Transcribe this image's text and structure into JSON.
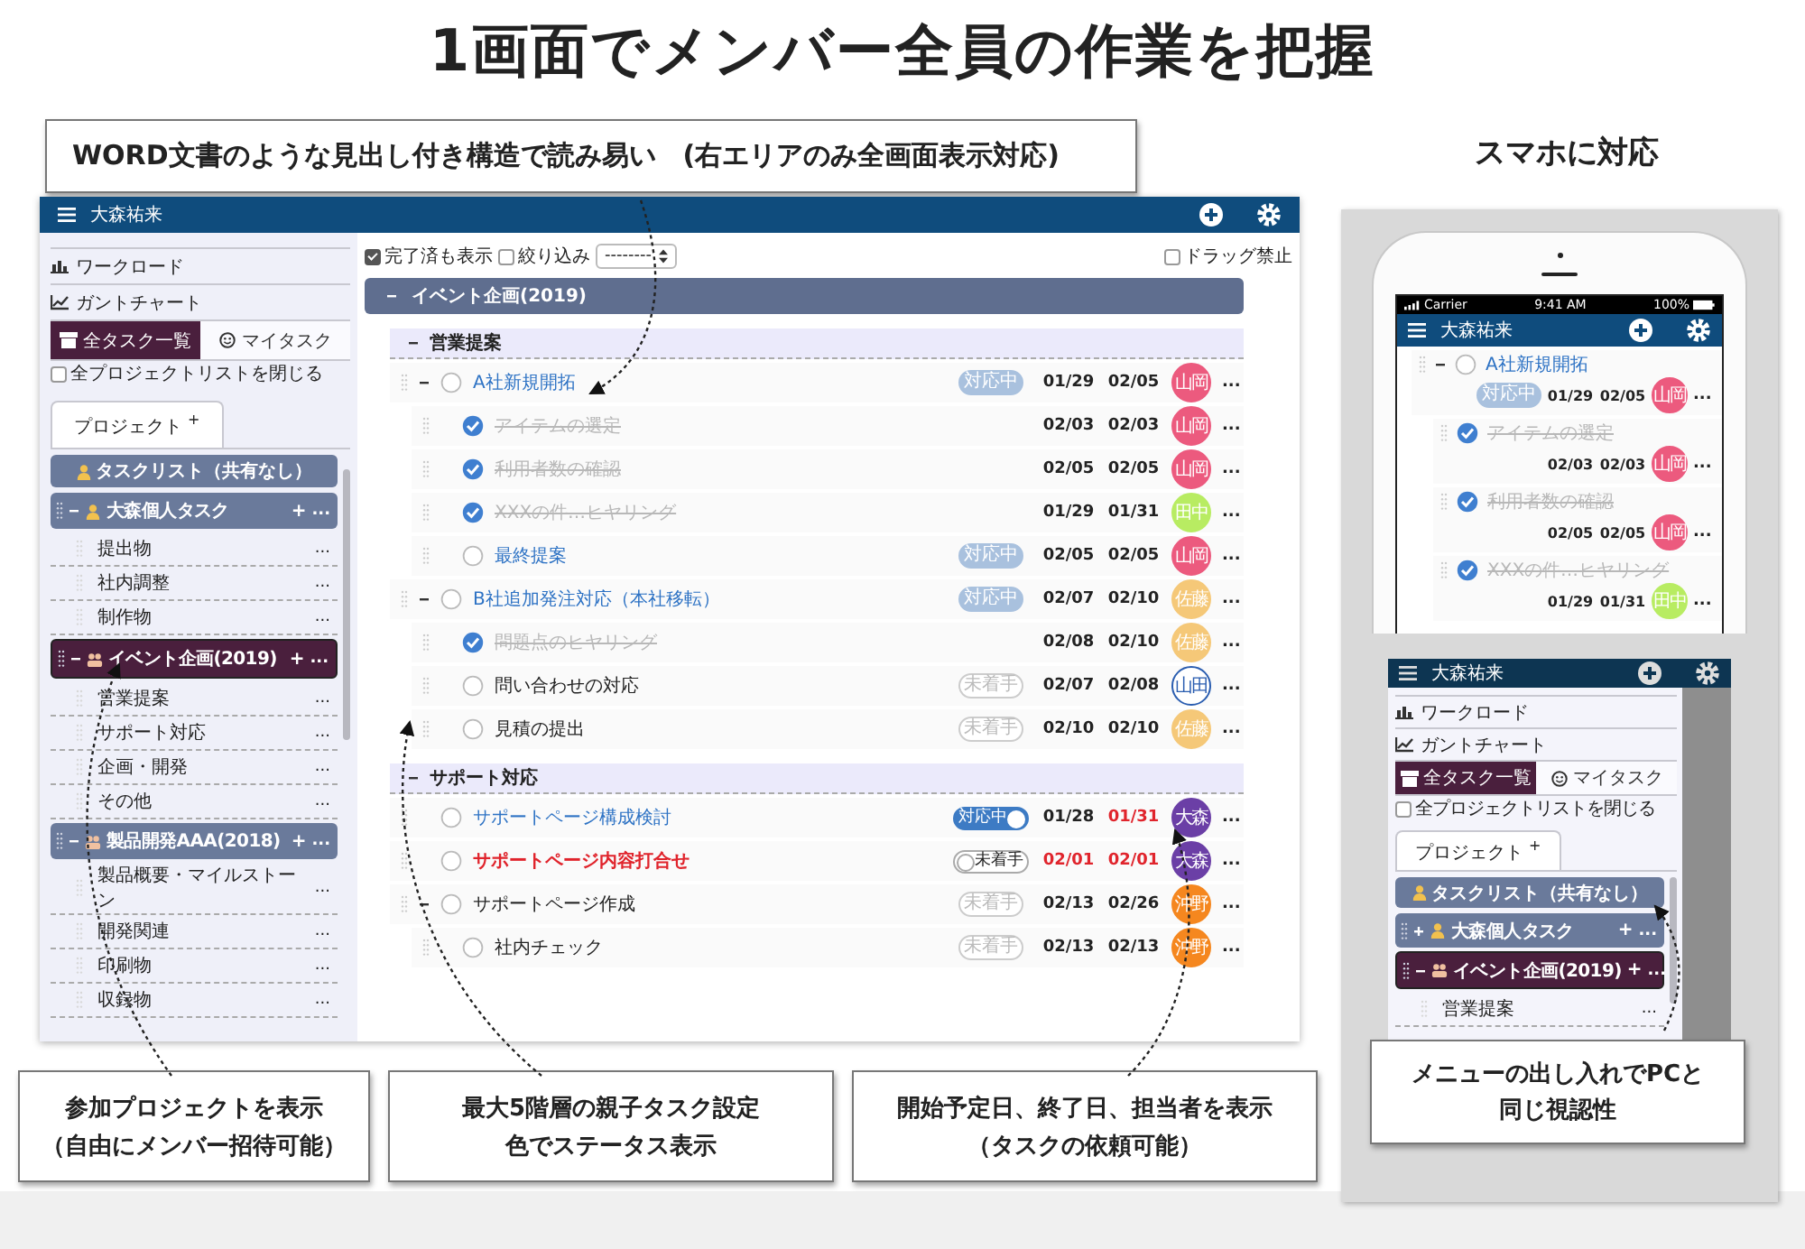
{
  "headline": "1画面でメンバー全員の作業を把握",
  "top_callout": "WORD文書のような見出し付き構造で読み易い　(右エリアのみ全画面表示対応)",
  "mobile_title": "スマホに対応",
  "app": {
    "user": "大森祐来",
    "sidebar": {
      "nav": [
        "ワークロード",
        "ガントチャート"
      ],
      "tabs": [
        {
          "label": "全タスク一覧",
          "selected": true
        },
        {
          "label": "マイタスク",
          "selected": false
        }
      ],
      "collapse_all": {
        "label": "全プロジェクトリストを閉じる",
        "checked": false
      },
      "project_tab": {
        "label": "プロジェクト",
        "add": "+"
      },
      "projects": [
        {
          "kind": "shared",
          "label": "タスクリスト（共有なし）",
          "selected": false
        },
        {
          "kind": "personal",
          "label": "大森個人タスク",
          "selected": false,
          "expanded": true,
          "add": "+",
          "menu": "...",
          "children": [
            {
              "label": "提出物",
              "menu": "..."
            },
            {
              "label": "社内調整",
              "menu": "..."
            },
            {
              "label": "制作物",
              "menu": "..."
            }
          ]
        },
        {
          "kind": "team",
          "label": "イベント企画(2019)",
          "selected": true,
          "expanded": true,
          "add": "+",
          "menu": "...",
          "children": [
            {
              "label": "営業提案",
              "menu": "..."
            },
            {
              "label": "サポート対応",
              "menu": "..."
            },
            {
              "label": "企画・開発",
              "menu": "..."
            },
            {
              "label": "その他",
              "menu": "..."
            }
          ]
        },
        {
          "kind": "team",
          "label": "製品開発AAA(2018)",
          "selected": false,
          "expanded": true,
          "add": "+",
          "menu": "...",
          "children": [
            {
              "label": "製品概要・マイルストーン",
              "menu": "..."
            },
            {
              "label": "開発関連",
              "menu": "..."
            },
            {
              "label": "印刷物",
              "menu": "..."
            },
            {
              "label": "収録物",
              "menu": "..."
            }
          ]
        }
      ]
    },
    "toolbar": {
      "show_done": {
        "label": "完了済も表示",
        "checked": true
      },
      "filter": {
        "label": "絞り込み",
        "checked": false
      },
      "select": "--------",
      "no_drag": {
        "label": "ドラッグ禁止",
        "checked": false
      }
    },
    "project_header": {
      "label": "イベント企画(2019)",
      "expanded": true
    },
    "groups": [
      {
        "title": "営業提案",
        "expanded": true,
        "tasks": [
          {
            "title": "A社新規開拓",
            "done": false,
            "expanded": true,
            "status": {
              "label": "対応中",
              "kind": "pill",
              "on": true
            },
            "start": "01/29",
            "end": "02/05",
            "start_overdue": false,
            "end_overdue": false,
            "assignee": {
              "name": "山岡",
              "color": "#ec5a7e"
            },
            "menu": "...",
            "children": [
              {
                "title": "アイテムの選定",
                "done": true,
                "start": "02/03",
                "end": "02/03",
                "start_overdue": false,
                "end_overdue": false,
                "assignee": {
                  "name": "山岡",
                  "color": "#ec5a7e"
                },
                "menu": "..."
              },
              {
                "title": "利用者数の確認",
                "done": true,
                "start": "02/05",
                "end": "02/05",
                "start_overdue": false,
                "end_overdue": false,
                "assignee": {
                  "name": "山岡",
                  "color": "#ec5a7e"
                },
                "menu": "..."
              },
              {
                "title": "XXXの件…ヒヤリング",
                "done": true,
                "start": "01/29",
                "end": "01/31",
                "start_overdue": false,
                "end_overdue": false,
                "assignee": {
                  "name": "田中",
                  "color": "#b8ec62"
                },
                "menu": "..."
              },
              {
                "title": "最終提案",
                "done": false,
                "status": {
                  "label": "対応中",
                  "kind": "pill",
                  "on": true
                },
                "start": "02/05",
                "end": "02/05",
                "start_overdue": false,
                "end_overdue": false,
                "assignee": {
                  "name": "山岡",
                  "color": "#ec5a7e"
                },
                "menu": "..."
              }
            ]
          },
          {
            "title": "B社追加発注対応（本社移転）",
            "done": false,
            "expanded": true,
            "status": {
              "label": "対応中",
              "kind": "pill",
              "on": true
            },
            "start": "02/07",
            "end": "02/10",
            "start_overdue": false,
            "end_overdue": false,
            "assignee": {
              "name": "佐藤",
              "color": "#f5c878"
            },
            "menu": "...",
            "children": [
              {
                "title": "問題点のヒヤリング",
                "done": true,
                "start": "02/08",
                "end": "02/10",
                "start_overdue": false,
                "end_overdue": false,
                "assignee": {
                  "name": "佐藤",
                  "color": "#f5c878"
                },
                "menu": "..."
              },
              {
                "title": "問い合わせの対応",
                "done": false,
                "status": {
                  "label": "未着手",
                  "kind": "pill",
                  "on": false
                },
                "start": "02/07",
                "end": "02/08",
                "start_overdue": false,
                "end_overdue": false,
                "assignee": {
                  "name": "山田",
                  "color": "#ffffff"
                },
                "menu": "..."
              },
              {
                "title": "見積の提出",
                "done": false,
                "status": {
                  "label": "未着手",
                  "kind": "pill",
                  "on": false
                },
                "start": "02/10",
                "end": "02/10",
                "start_overdue": false,
                "end_overdue": false,
                "assignee": {
                  "name": "佐藤",
                  "color": "#f5c878"
                },
                "menu": "..."
              }
            ]
          }
        ]
      },
      {
        "title": "サポート対応",
        "expanded": true,
        "tasks": [
          {
            "title": "サポートページ構成検討",
            "done": false,
            "status": {
              "label": "対応中",
              "kind": "toggle",
              "on": true
            },
            "start": "01/28",
            "end": "01/31",
            "start_overdue": false,
            "end_overdue": true,
            "assignee": {
              "name": "大森",
              "color": "#6b3fa6"
            },
            "menu": "..."
          },
          {
            "title": "サポートページ内容打合せ",
            "done": false,
            "status": {
              "label": "未着手",
              "kind": "toggle",
              "on": false
            },
            "start": "02/01",
            "end": "02/01",
            "start_overdue": true,
            "end_overdue": true,
            "assignee": {
              "name": "大森",
              "color": "#6b3fa6"
            },
            "menu": "..."
          },
          {
            "title": "サポートページ作成",
            "done": false,
            "expanded": true,
            "status": {
              "label": "未着手",
              "kind": "pill",
              "on": false
            },
            "start": "02/13",
            "end": "02/26",
            "start_overdue": false,
            "end_overdue": false,
            "assignee": {
              "name": "沖野",
              "color": "#f5871f"
            },
            "menu": "...",
            "children": [
              {
                "title": "社内チェック",
                "done": false,
                "status": {
                  "label": "未着手",
                  "kind": "pill",
                  "on": false
                },
                "start": "02/13",
                "end": "02/13",
                "start_overdue": false,
                "end_overdue": false,
                "assignee": {
                  "name": "沖野",
                  "color": "#f5871f"
                },
                "menu": "..."
              }
            ]
          }
        ]
      }
    ]
  },
  "bottom_callouts": [
    {
      "lines": [
        "参加プロジェクトを表示",
        "（自由にメンバー招待可能）"
      ]
    },
    {
      "lines": [
        "最大5階層の親子タスク設定",
        "色でステータス表示"
      ]
    },
    {
      "lines": [
        "開始予定日、終了日、担当者を表示",
        "（タスクの依頼可能）"
      ]
    }
  ],
  "phone": {
    "carrier": "Carrier",
    "time": "9:41 AM",
    "battery": "100%",
    "user": "大森祐来",
    "tasks": [
      {
        "title": "A社新規開拓",
        "done": false,
        "expanded": true,
        "status": {
          "label": "対応中",
          "kind": "pill",
          "on": true
        },
        "start": "01/29",
        "end": "02/05",
        "start_overdue": false,
        "end_overdue": false,
        "assignee": {
          "name": "山岡",
          "color": "#ec5a7e"
        },
        "menu": "...",
        "children": [
          {
            "title": "アイテムの選定",
            "done": true,
            "start": "02/03",
            "end": "02/03",
            "start_overdue": false,
            "end_overdue": false,
            "assignee": {
              "name": "山岡",
              "color": "#ec5a7e"
            },
            "menu": "..."
          },
          {
            "title": "利用者数の確認",
            "done": true,
            "start": "02/05",
            "end": "02/05",
            "start_overdue": false,
            "end_overdue": false,
            "assignee": {
              "name": "山岡",
              "color": "#ec5a7e"
            },
            "menu": "..."
          },
          {
            "title": "XXXの件…ヒヤリング",
            "done": true,
            "start": "01/29",
            "end": "01/31",
            "start_overdue": false,
            "end_overdue": false,
            "assignee": {
              "name": "田中",
              "color": "#b8ec62"
            },
            "menu": "..."
          }
        ]
      }
    ]
  },
  "phone_menu": {
    "user": "大森祐来",
    "nav": [
      "ワークロード",
      "ガントチャート"
    ],
    "tabs": [
      {
        "label": "全タスク一覧",
        "selected": true
      },
      {
        "label": "マイタスク",
        "selected": false
      }
    ],
    "collapse_all": {
      "label": "全プロジェクトリストを閉じる",
      "checked": false
    },
    "project_tab": {
      "label": "プロジェクト",
      "add": "+"
    },
    "projects": [
      {
        "kind": "shared",
        "label": "タスクリスト（共有なし）",
        "selected": false
      },
      {
        "kind": "personal",
        "label": "大森個人タスク",
        "selected": false,
        "expanded": false,
        "add": "+",
        "menu": "..."
      },
      {
        "kind": "team",
        "label": "イベント企画(2019)",
        "selected": true,
        "expanded": true,
        "add": "+",
        "menu": "...",
        "children": [
          {
            "label": "営業提案",
            "menu": "..."
          }
        ]
      }
    ]
  },
  "phone_callout": {
    "lines": [
      "メニューの出し入れでPCと",
      "同じ視認性"
    ]
  }
}
